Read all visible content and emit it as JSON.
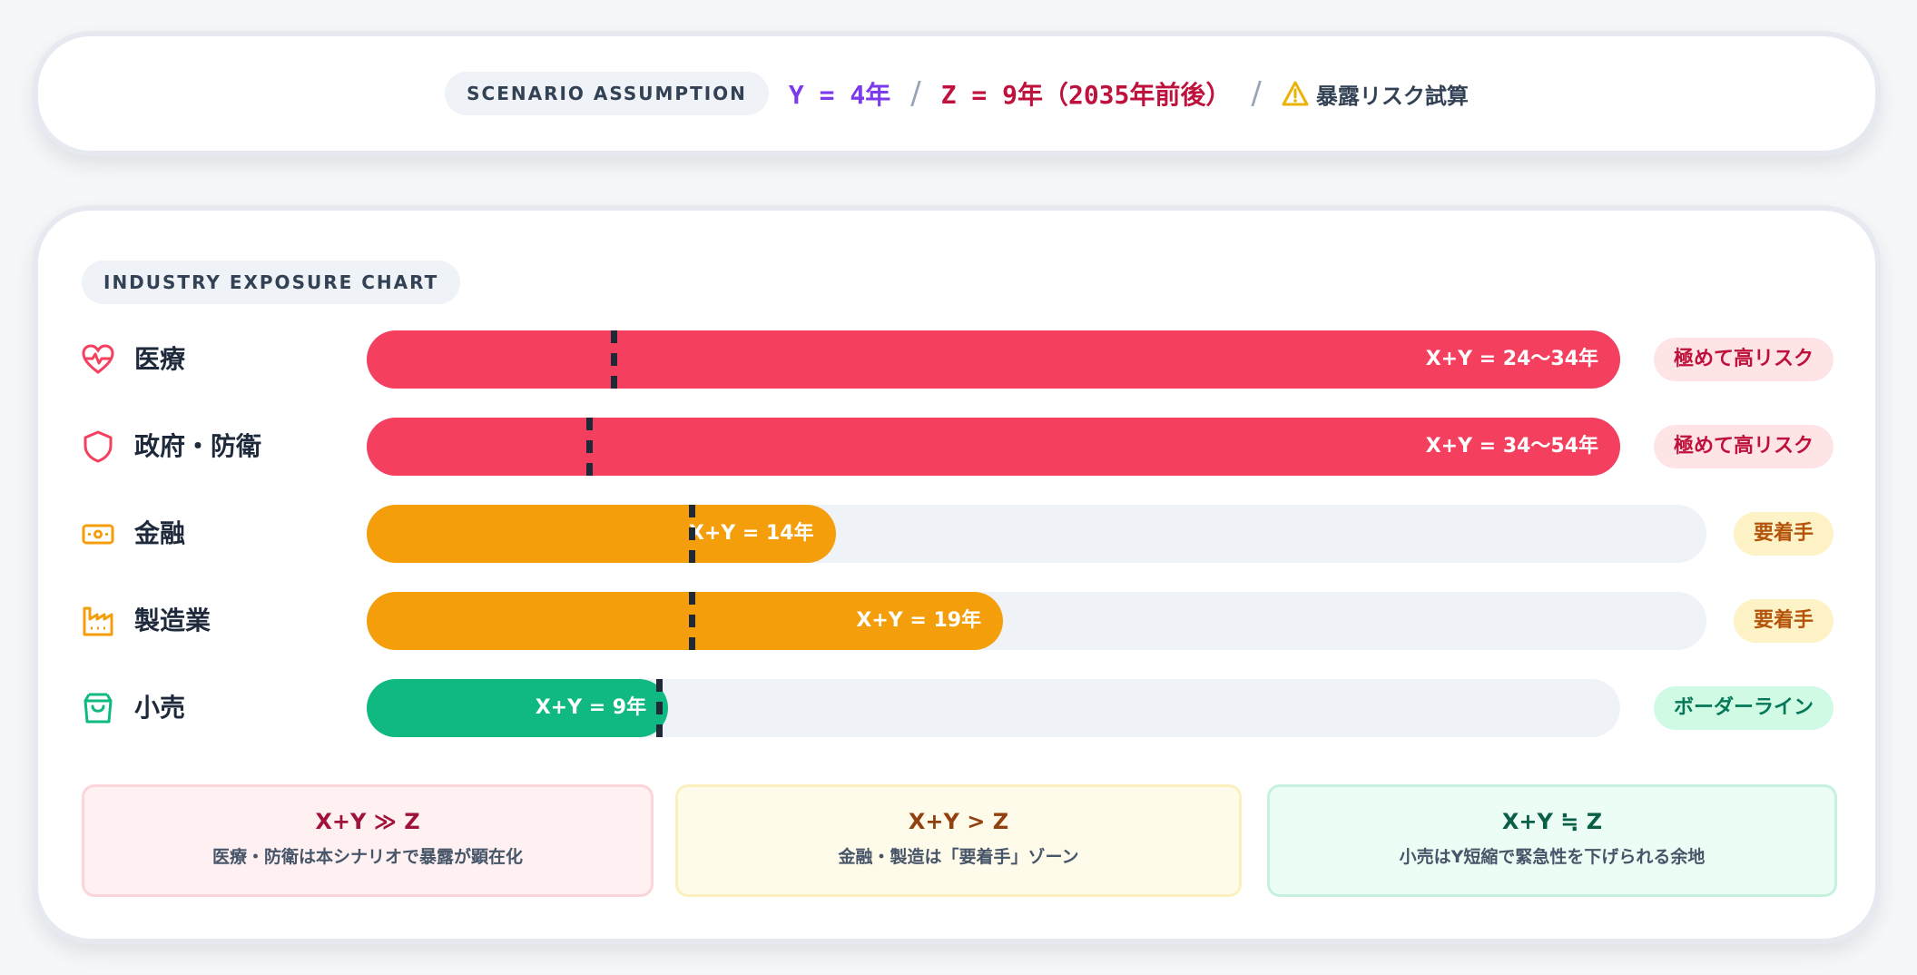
{
  "assumption": {
    "pill": "SCENARIO ASSUMPTION",
    "y_text": "Y = 4年",
    "z_text": "Z = 9年（2035年前後）",
    "separator": "/",
    "warning_text": "暴露リスク試算"
  },
  "chart_data": {
    "type": "bar",
    "title": "INDUSTRY EXPOSURE CHART",
    "reference_Z_years": 9,
    "categories": [
      "医療",
      "政府・防衛",
      "金融",
      "製造業",
      "小売"
    ],
    "series": [
      {
        "values_text": [
          "X+Y = 24〜34年",
          "X+Y = 34〜54年",
          "X+Y = 14年",
          "X+Y = 19年",
          "X+Y = 9年"
        ],
        "ranges": [
          [
            24,
            34
          ],
          [
            34,
            54
          ],
          [
            14,
            14
          ],
          [
            19,
            19
          ],
          [
            9,
            9
          ]
        ]
      }
    ],
    "risk_labels": [
      "極めて高リスク",
      "極めて高リスク",
      "要着手",
      "要着手",
      "ボーダーライン"
    ],
    "colors": {
      "high": "#f43f5e",
      "mid": "#f59e0b",
      "low": "#10b981"
    }
  },
  "icons": [
    "heart-pulse-icon",
    "shield-icon",
    "banknote-icon",
    "factory-icon",
    "shopping-bag-icon"
  ],
  "summaries": [
    {
      "title": "X+Y ≫ Z",
      "desc": "医療・防衛は本シナリオで暴露が顕在化"
    },
    {
      "title": "X+Y > Z",
      "desc": "金融・製造は「要着手」ゾーン"
    },
    {
      "title": "X+Y ≒ Z",
      "desc": "小売はY短縮で緊急性を下げられる余地"
    }
  ]
}
